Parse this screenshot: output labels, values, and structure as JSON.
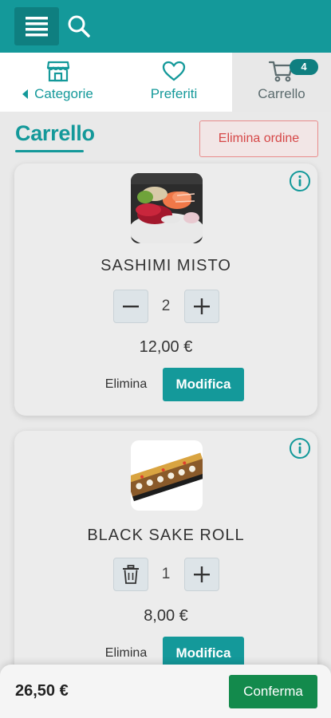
{
  "header": {
    "menu_icon": "hamburger-icon",
    "search_icon": "search-icon",
    "color": "#14999a"
  },
  "tabs": [
    {
      "label": "Categorie",
      "icon": "store-icon"
    },
    {
      "label": "Preferiti",
      "icon": "heart-icon"
    },
    {
      "label": "Carrello",
      "icon": "cart-icon",
      "badge": "4"
    }
  ],
  "page": {
    "title": "Carrello",
    "delete_order_label": "Elimina ordine"
  },
  "items": [
    {
      "name": "SASHIMI MISTO",
      "quantity": "2",
      "price": "12,00 €",
      "delete_label": "Elimina",
      "edit_label": "Modifica",
      "minus_icon": "minus-icon"
    },
    {
      "name": "BLACK SAKE ROLL",
      "quantity": "1",
      "price": "8,00 €",
      "delete_label": "Elimina",
      "edit_label": "Modifica",
      "minus_icon": "trash-icon"
    }
  ],
  "footer": {
    "total": "26,50 €",
    "confirm_label": "Conferma"
  }
}
